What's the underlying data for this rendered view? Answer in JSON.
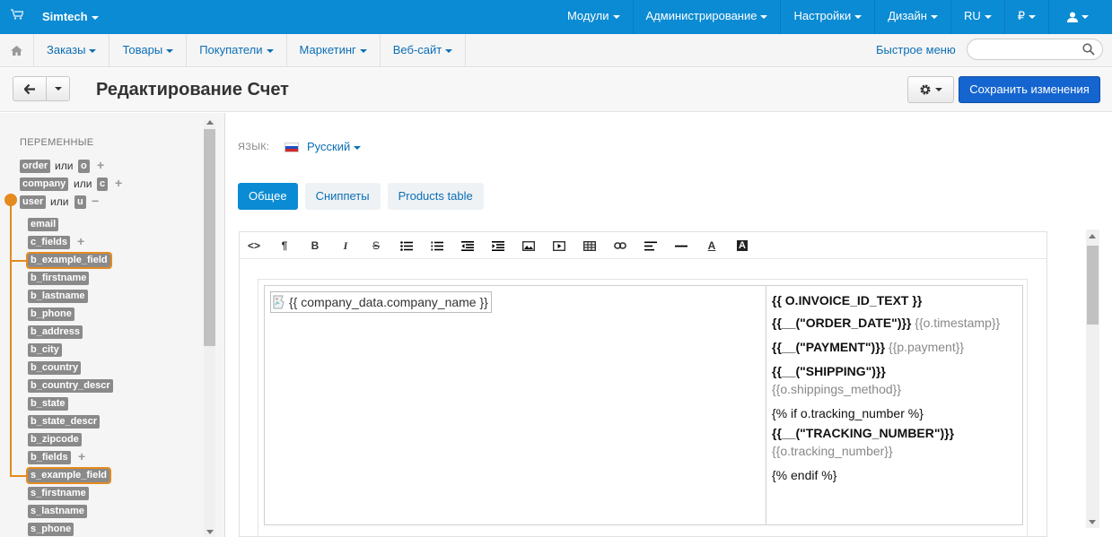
{
  "topbar": {
    "brand": "Simtech",
    "items": [
      "Модули",
      "Администрирование",
      "Настройки",
      "Дизайн",
      "RU",
      "₽"
    ]
  },
  "subnav": {
    "items": [
      "Заказы",
      "Товары",
      "Покупатели",
      "Маркетинг",
      "Веб-сайт"
    ],
    "quick_menu": "Быстрое меню",
    "search_placeholder": ""
  },
  "page": {
    "title": "Редактирование Счет",
    "save_label": "Сохранить изменения"
  },
  "sidebar": {
    "heading": "ПЕРЕМЕННЫЕ",
    "or_word": "или",
    "groups": {
      "order": {
        "name": "order",
        "short": "o"
      },
      "company": {
        "name": "company",
        "short": "c"
      },
      "user": {
        "name": "user",
        "short": "u"
      }
    },
    "user_fields": [
      "email",
      "c_fields",
      "b_example_field",
      "b_firstname",
      "b_lastname",
      "b_phone",
      "b_address",
      "b_city",
      "b_country",
      "b_country_descr",
      "b_state",
      "b_state_descr",
      "b_zipcode",
      "b_fields",
      "s_example_field",
      "s_firstname",
      "s_lastname",
      "s_phone"
    ],
    "highlighted": [
      "b_example_field",
      "s_example_field"
    ]
  },
  "language": {
    "label": "ЯЗЫК:",
    "value": "Русский"
  },
  "tabs": [
    "Общее",
    "Сниппеты",
    "Products table"
  ],
  "active_tab": "Общее",
  "editor": {
    "image_alt": "{{ company_data.company_name }}",
    "lines": {
      "invoice_id": "{{ O.INVOICE_ID_TEXT }}",
      "order_date_label": "{{__(\"ORDER_DATE\")}}",
      "order_date_value": "{{o.timestamp}}",
      "payment_label": "{{__(\"PAYMENT\")}}",
      "payment_value": "{{p.payment}}",
      "shipping_label": "{{__(\"SHIPPING\")}}",
      "shipping_value": "{{o.shippings_method}}",
      "if_tracking": "{% if o.tracking_number %}",
      "tracking_label": "{{__(\"TRACKING_NUMBER\")}}",
      "tracking_value": "{{o.tracking_number}}",
      "endif": "{% endif %}"
    }
  },
  "colors": {
    "topbar": "#0b8bd3",
    "primary_button": "#1565d0",
    "highlight": "#e58a1f",
    "variable_tag": "#8a8a8a"
  }
}
